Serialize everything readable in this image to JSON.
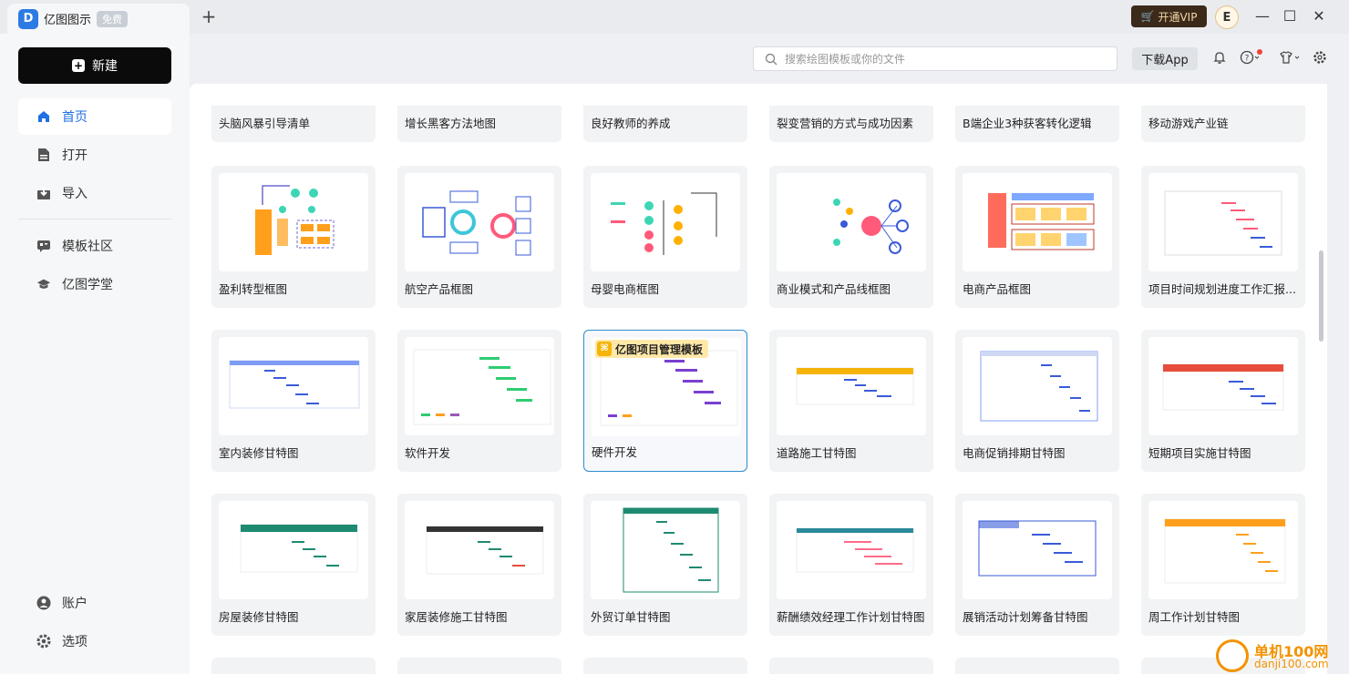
{
  "app": {
    "tab_title": "亿图图示",
    "tab_badge": "免费",
    "logo_glyph": "D",
    "vip_label": "开通VIP",
    "avatar_letter": "E"
  },
  "sidebar": {
    "new_label": "新建",
    "items": [
      {
        "label": "首页",
        "icon": "home-icon",
        "active": true
      },
      {
        "label": "打开",
        "icon": "file-icon"
      },
      {
        "label": "导入",
        "icon": "import-icon"
      },
      {
        "label": "模板社区",
        "icon": "community-icon"
      },
      {
        "label": "亿图学堂",
        "icon": "graduation-cap-icon"
      },
      {
        "label": "账户",
        "icon": "user-icon"
      },
      {
        "label": "选项",
        "icon": "gear-icon"
      }
    ]
  },
  "topbar": {
    "search_placeholder": "搜索绘图模板或你的文件",
    "download_app": "下载App"
  },
  "templates": {
    "row0": [
      "头脑风暴引导清单",
      "增长黑客方法地图",
      "良好教师的养成",
      "裂变营销的方式与成功因素",
      "B端企业3种获客转化逻辑",
      "移动游戏产业链"
    ],
    "row1": [
      "盈利转型框图",
      "航空产品框图",
      "母婴电商框图",
      "商业模式和产品线框图",
      "电商产品框图",
      "项目时间规划进度工作汇报..."
    ],
    "row2": [
      "室内装修甘特图",
      "软件开发",
      "硬件开发",
      "道路施工甘特图",
      "电商促销排期甘特图",
      "短期项目实施甘特图"
    ],
    "row3": [
      "房屋装修甘特图",
      "家居装修施工甘特图",
      "外贸订单甘特图",
      "薪酬绩效经理工作计划甘特图",
      "展销活动计划筹备甘特图",
      "周工作计划甘特图"
    ],
    "featured_tag": "亿图项目管理模板"
  },
  "watermark": {
    "title": "单机100网",
    "url": "danji100.com"
  },
  "colors": {
    "accent": "#1f6fe5",
    "vip_bg": "#3b2a1a",
    "highlight_border": "#2f8ecf"
  }
}
